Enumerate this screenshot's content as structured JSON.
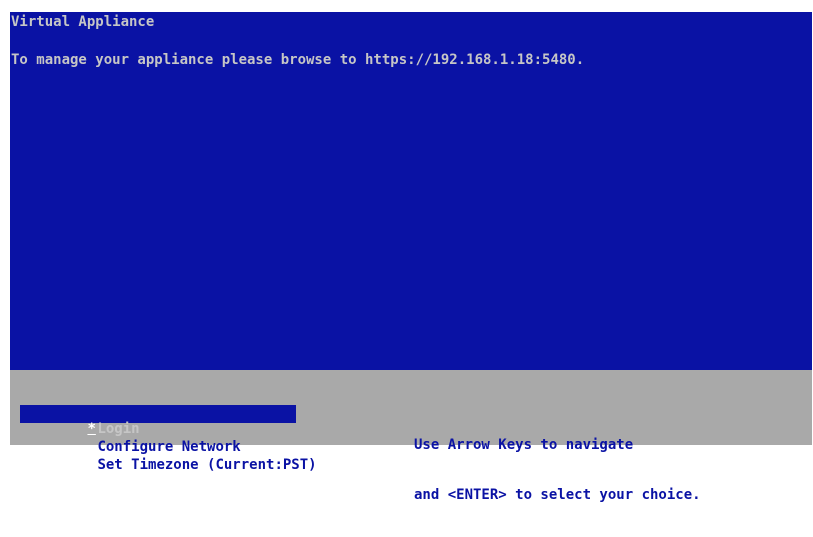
{
  "screen": {
    "title": "Virtual Appliance",
    "message": "To manage your appliance please browse to https://192.168.1.18:5480."
  },
  "menu": {
    "selected_marker": "*",
    "items": [
      {
        "label": "Login",
        "selected": true
      },
      {
        "label": "Configure Network",
        "selected": false
      },
      {
        "label": "Set Timezone (Current:PST)",
        "selected": false
      }
    ]
  },
  "help": {
    "line1": "Use Arrow Keys to navigate",
    "line2": "and <ENTER> to select your choice."
  },
  "colors": {
    "top_background": "#0a12a4",
    "top_text": "#c6c6c6",
    "bottom_background": "#a9a9a9",
    "bottom_text": "#0a12a4"
  }
}
